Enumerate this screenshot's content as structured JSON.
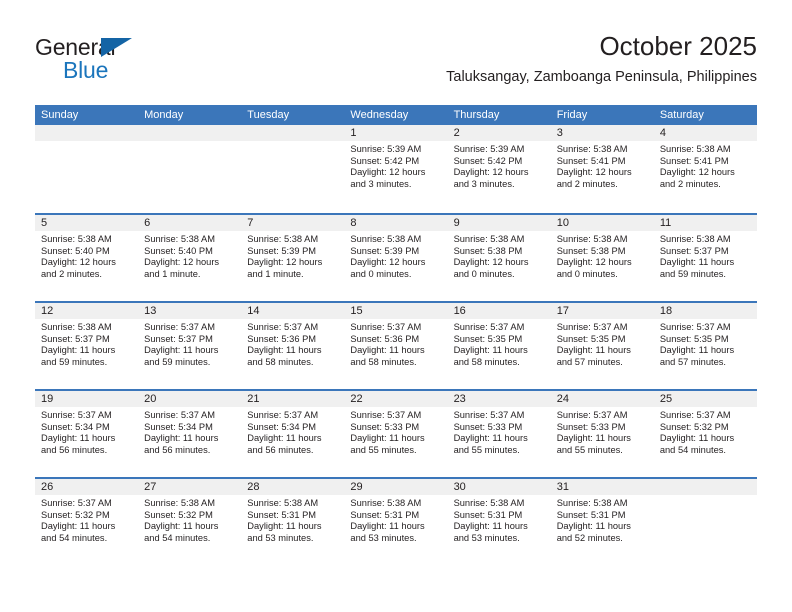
{
  "logo": {
    "word1": "General",
    "word2": "Blue",
    "triangle_color": "#1464a5",
    "blue_color": "#1b75bc"
  },
  "header": {
    "title": "October 2025",
    "subtitle": "Taluksangay, Zamboanga Peninsula, Philippines"
  },
  "theme": {
    "header_bar": "#3b76ba",
    "day_head_bg": "#f0f0f0",
    "text": "#231f20"
  },
  "weekdays": [
    "Sunday",
    "Monday",
    "Tuesday",
    "Wednesday",
    "Thursday",
    "Friday",
    "Saturday"
  ],
  "weeks": [
    [
      {
        "day": "",
        "lines": []
      },
      {
        "day": "",
        "lines": []
      },
      {
        "day": "",
        "lines": []
      },
      {
        "day": "1",
        "lines": [
          "Sunrise: 5:39 AM",
          "Sunset: 5:42 PM",
          "Daylight: 12 hours",
          "and 3 minutes."
        ]
      },
      {
        "day": "2",
        "lines": [
          "Sunrise: 5:39 AM",
          "Sunset: 5:42 PM",
          "Daylight: 12 hours",
          "and 3 minutes."
        ]
      },
      {
        "day": "3",
        "lines": [
          "Sunrise: 5:38 AM",
          "Sunset: 5:41 PM",
          "Daylight: 12 hours",
          "and 2 minutes."
        ]
      },
      {
        "day": "4",
        "lines": [
          "Sunrise: 5:38 AM",
          "Sunset: 5:41 PM",
          "Daylight: 12 hours",
          "and 2 minutes."
        ]
      }
    ],
    [
      {
        "day": "5",
        "lines": [
          "Sunrise: 5:38 AM",
          "Sunset: 5:40 PM",
          "Daylight: 12 hours",
          "and 2 minutes."
        ]
      },
      {
        "day": "6",
        "lines": [
          "Sunrise: 5:38 AM",
          "Sunset: 5:40 PM",
          "Daylight: 12 hours",
          "and 1 minute."
        ]
      },
      {
        "day": "7",
        "lines": [
          "Sunrise: 5:38 AM",
          "Sunset: 5:39 PM",
          "Daylight: 12 hours",
          "and 1 minute."
        ]
      },
      {
        "day": "8",
        "lines": [
          "Sunrise: 5:38 AM",
          "Sunset: 5:39 PM",
          "Daylight: 12 hours",
          "and 0 minutes."
        ]
      },
      {
        "day": "9",
        "lines": [
          "Sunrise: 5:38 AM",
          "Sunset: 5:38 PM",
          "Daylight: 12 hours",
          "and 0 minutes."
        ]
      },
      {
        "day": "10",
        "lines": [
          "Sunrise: 5:38 AM",
          "Sunset: 5:38 PM",
          "Daylight: 12 hours",
          "and 0 minutes."
        ]
      },
      {
        "day": "11",
        "lines": [
          "Sunrise: 5:38 AM",
          "Sunset: 5:37 PM",
          "Daylight: 11 hours",
          "and 59 minutes."
        ]
      }
    ],
    [
      {
        "day": "12",
        "lines": [
          "Sunrise: 5:38 AM",
          "Sunset: 5:37 PM",
          "Daylight: 11 hours",
          "and 59 minutes."
        ]
      },
      {
        "day": "13",
        "lines": [
          "Sunrise: 5:37 AM",
          "Sunset: 5:37 PM",
          "Daylight: 11 hours",
          "and 59 minutes."
        ]
      },
      {
        "day": "14",
        "lines": [
          "Sunrise: 5:37 AM",
          "Sunset: 5:36 PM",
          "Daylight: 11 hours",
          "and 58 minutes."
        ]
      },
      {
        "day": "15",
        "lines": [
          "Sunrise: 5:37 AM",
          "Sunset: 5:36 PM",
          "Daylight: 11 hours",
          "and 58 minutes."
        ]
      },
      {
        "day": "16",
        "lines": [
          "Sunrise: 5:37 AM",
          "Sunset: 5:35 PM",
          "Daylight: 11 hours",
          "and 58 minutes."
        ]
      },
      {
        "day": "17",
        "lines": [
          "Sunrise: 5:37 AM",
          "Sunset: 5:35 PM",
          "Daylight: 11 hours",
          "and 57 minutes."
        ]
      },
      {
        "day": "18",
        "lines": [
          "Sunrise: 5:37 AM",
          "Sunset: 5:35 PM",
          "Daylight: 11 hours",
          "and 57 minutes."
        ]
      }
    ],
    [
      {
        "day": "19",
        "lines": [
          "Sunrise: 5:37 AM",
          "Sunset: 5:34 PM",
          "Daylight: 11 hours",
          "and 56 minutes."
        ]
      },
      {
        "day": "20",
        "lines": [
          "Sunrise: 5:37 AM",
          "Sunset: 5:34 PM",
          "Daylight: 11 hours",
          "and 56 minutes."
        ]
      },
      {
        "day": "21",
        "lines": [
          "Sunrise: 5:37 AM",
          "Sunset: 5:34 PM",
          "Daylight: 11 hours",
          "and 56 minutes."
        ]
      },
      {
        "day": "22",
        "lines": [
          "Sunrise: 5:37 AM",
          "Sunset: 5:33 PM",
          "Daylight: 11 hours",
          "and 55 minutes."
        ]
      },
      {
        "day": "23",
        "lines": [
          "Sunrise: 5:37 AM",
          "Sunset: 5:33 PM",
          "Daylight: 11 hours",
          "and 55 minutes."
        ]
      },
      {
        "day": "24",
        "lines": [
          "Sunrise: 5:37 AM",
          "Sunset: 5:33 PM",
          "Daylight: 11 hours",
          "and 55 minutes."
        ]
      },
      {
        "day": "25",
        "lines": [
          "Sunrise: 5:37 AM",
          "Sunset: 5:32 PM",
          "Daylight: 11 hours",
          "and 54 minutes."
        ]
      }
    ],
    [
      {
        "day": "26",
        "lines": [
          "Sunrise: 5:37 AM",
          "Sunset: 5:32 PM",
          "Daylight: 11 hours",
          "and 54 minutes."
        ]
      },
      {
        "day": "27",
        "lines": [
          "Sunrise: 5:38 AM",
          "Sunset: 5:32 PM",
          "Daylight: 11 hours",
          "and 54 minutes."
        ]
      },
      {
        "day": "28",
        "lines": [
          "Sunrise: 5:38 AM",
          "Sunset: 5:31 PM",
          "Daylight: 11 hours",
          "and 53 minutes."
        ]
      },
      {
        "day": "29",
        "lines": [
          "Sunrise: 5:38 AM",
          "Sunset: 5:31 PM",
          "Daylight: 11 hours",
          "and 53 minutes."
        ]
      },
      {
        "day": "30",
        "lines": [
          "Sunrise: 5:38 AM",
          "Sunset: 5:31 PM",
          "Daylight: 11 hours",
          "and 53 minutes."
        ]
      },
      {
        "day": "31",
        "lines": [
          "Sunrise: 5:38 AM",
          "Sunset: 5:31 PM",
          "Daylight: 11 hours",
          "and 52 minutes."
        ]
      },
      {
        "day": "",
        "lines": []
      }
    ]
  ]
}
